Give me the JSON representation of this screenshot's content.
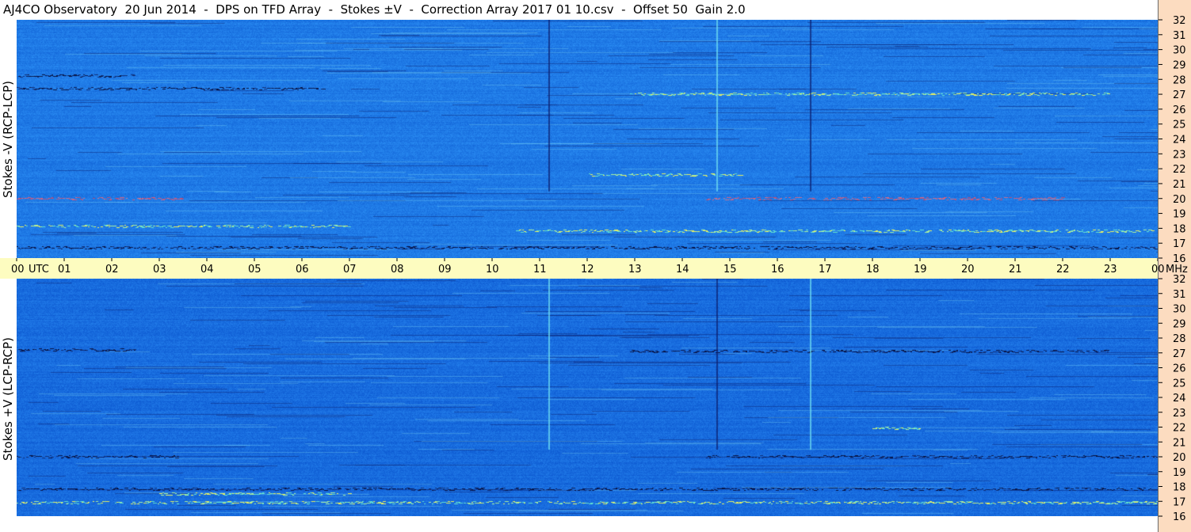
{
  "title": "AJ4CO Observatory  20 Jun 2014  -  DPS on TFD Array  -  Stokes ±V  -  Correction Array 2017 01 10.csv  -  Offset 50  Gain 2.0",
  "colors": {
    "background_blue": "#1f7ae6",
    "freq_axis_bg": "#fcdcc0",
    "time_axis_bg": "#fdfcc0"
  },
  "chart_data": {
    "type": "heatmap",
    "title": "AJ4CO Observatory  20 Jun 2014  -  DPS on TFD Array  -  Stokes ±V  -  Correction Array 2017 01 10.csv  -  Offset 50  Gain 2.0",
    "xlabel": "UTC",
    "ylabel_unit": "MHz",
    "x_ticks": [
      "00",
      "01",
      "02",
      "03",
      "04",
      "05",
      "06",
      "07",
      "08",
      "09",
      "10",
      "11",
      "12",
      "13",
      "14",
      "15",
      "16",
      "17",
      "18",
      "19",
      "20",
      "21",
      "22",
      "23",
      "00"
    ],
    "x_range_hours": [
      0,
      24
    ],
    "y_ticks": [
      16,
      17,
      18,
      19,
      20,
      21,
      22,
      23,
      24,
      25,
      26,
      27,
      28,
      29,
      30,
      31,
      32
    ],
    "y_range_mhz": [
      16,
      32
    ],
    "panels": [
      {
        "name": "Stokes -V (RCP-LCP)",
        "bands": [
          {
            "mhz": 27.0,
            "t0": 12.9,
            "t1": 23.0,
            "level": "bright"
          },
          {
            "mhz": 21.6,
            "t0": 11.9,
            "t1": 15.3,
            "level": "bright"
          },
          {
            "mhz": 17.8,
            "t0": 10.5,
            "t1": 23.9,
            "level": "bright"
          },
          {
            "mhz": 18.1,
            "t0": 0.0,
            "t1": 7.0,
            "level": "bright"
          },
          {
            "mhz": 28.2,
            "t0": 0.0,
            "t1": 2.5,
            "level": "dark"
          },
          {
            "mhz": 27.4,
            "t0": 0.0,
            "t1": 6.5,
            "level": "dark"
          },
          {
            "mhz": 16.7,
            "t0": 0.0,
            "t1": 24.0,
            "level": "dark"
          },
          {
            "mhz": 20.0,
            "t0": 0.0,
            "t1": 3.5,
            "level": "red"
          },
          {
            "mhz": 20.0,
            "t0": 14.5,
            "t1": 22.0,
            "level": "red"
          }
        ],
        "verticals": [
          {
            "hour": 11.18,
            "level": "dark"
          },
          {
            "hour": 14.72,
            "level": "bright"
          },
          {
            "hour": 16.68,
            "level": "dark"
          }
        ]
      },
      {
        "name": "Stokes +V (LCP-RCP)",
        "bands": [
          {
            "mhz": 27.2,
            "t0": 0.0,
            "t1": 2.5,
            "level": "dark"
          },
          {
            "mhz": 27.1,
            "t0": 12.9,
            "t1": 23.0,
            "level": "dark"
          },
          {
            "mhz": 20.0,
            "t0": 0.0,
            "t1": 3.5,
            "level": "dark"
          },
          {
            "mhz": 20.0,
            "t0": 14.5,
            "t1": 24.0,
            "level": "dark"
          },
          {
            "mhz": 17.8,
            "t0": 0.0,
            "t1": 24.0,
            "level": "dark"
          },
          {
            "mhz": 17.5,
            "t0": 3.0,
            "t1": 7.0,
            "level": "bright"
          },
          {
            "mhz": 21.9,
            "t0": 18.0,
            "t1": 19.0,
            "level": "bright"
          },
          {
            "mhz": 16.9,
            "t0": 0.0,
            "t1": 24.0,
            "level": "bright"
          }
        ],
        "verticals": [
          {
            "hour": 11.18,
            "level": "bright"
          },
          {
            "hour": 14.72,
            "level": "dark"
          },
          {
            "hour": 16.68,
            "level": "bright"
          }
        ]
      }
    ]
  }
}
